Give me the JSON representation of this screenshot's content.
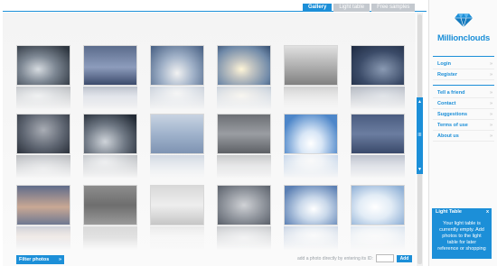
{
  "tabs": [
    {
      "label": "Gallery",
      "active": true
    },
    {
      "label": "Light table",
      "active": false
    },
    {
      "label": "Free samples",
      "active": false
    }
  ],
  "brand": {
    "name": "Millionclouds",
    "color": "#1c8fd8"
  },
  "account_menu": [
    {
      "label": "Login"
    },
    {
      "label": "Register"
    }
  ],
  "info_menu": [
    {
      "label": "Tell a friend"
    },
    {
      "label": "Contact"
    },
    {
      "label": "Suggestions"
    },
    {
      "label": "Terms of use"
    },
    {
      "label": "About us"
    }
  ],
  "light_table": {
    "title": "Light Table",
    "close": "x",
    "message": "Your light table is currently empty. Add photos to the light table for later reference or shopping"
  },
  "filter": {
    "label": "Filter photos",
    "arrow": "»"
  },
  "add_photo": {
    "label": "add a photo directly by entering its ID:",
    "input_value": "",
    "button": "Add"
  },
  "scroll_buttons": {
    "up": "▲",
    "mid": "III",
    "down": "▼"
  },
  "photos": [
    {
      "name": "dark-storm-clouds"
    },
    {
      "name": "blue-stratus"
    },
    {
      "name": "cumulus-blue-sky"
    },
    {
      "name": "sun-rays"
    },
    {
      "name": "grey-overcast"
    },
    {
      "name": "dark-blue-clouds"
    },
    {
      "name": "grey-storm"
    },
    {
      "name": "dark-cumulus"
    },
    {
      "name": "pale-blue-sky"
    },
    {
      "name": "grey-layer"
    },
    {
      "name": "white-cumulus-blue"
    },
    {
      "name": "blue-evening"
    },
    {
      "name": "sunset-clouds"
    },
    {
      "name": "grey-texture"
    },
    {
      "name": "light-overcast"
    },
    {
      "name": "grey-clouds"
    },
    {
      "name": "blue-white-clouds"
    },
    {
      "name": "bright-white-clouds"
    }
  ]
}
